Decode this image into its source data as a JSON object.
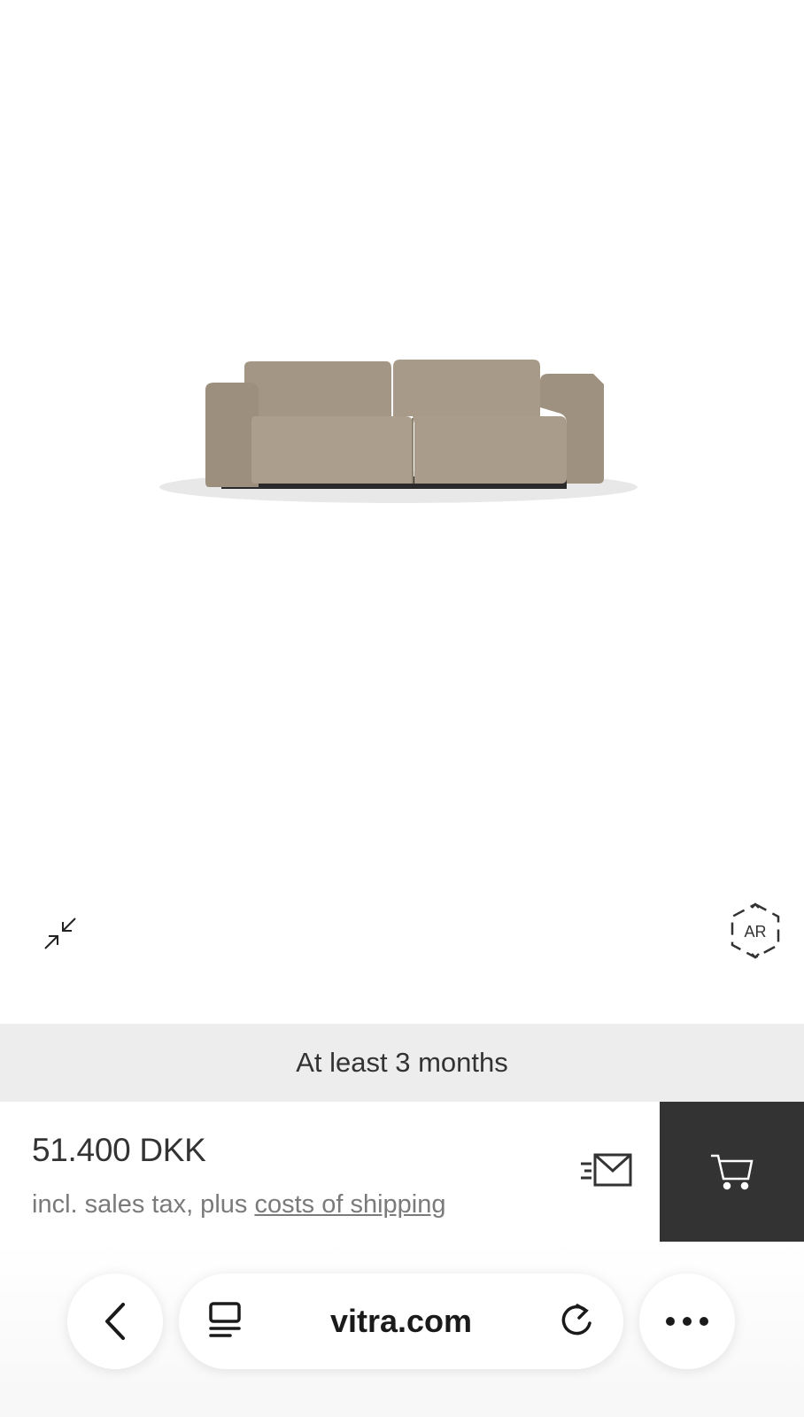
{
  "viewer": {
    "product_image": "sofa-icon",
    "collapse_icon": "collapse-icon",
    "ar_label": "AR"
  },
  "delivery": {
    "text": "At least 3 months"
  },
  "purchase": {
    "price": "51.400 DKK",
    "tax_prefix": "incl. sales tax, plus ",
    "shipping_link": "costs of shipping",
    "mail_icon": "mail-send-icon",
    "cart_icon": "cart-icon"
  },
  "browser": {
    "url": "vitra.com",
    "back_icon": "chevron-left-icon",
    "tabs_icon": "tabs-icon",
    "reload_icon": "reload-icon",
    "more_icon": "more-icon"
  },
  "colors": {
    "sofa": "#a89b8b",
    "cart_bg": "#333333",
    "delivery_bg": "#ededed"
  }
}
